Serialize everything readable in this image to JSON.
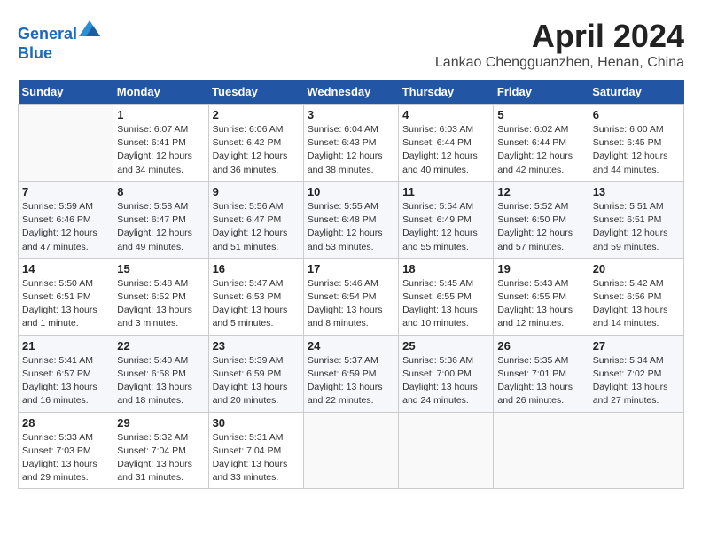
{
  "header": {
    "logo_line1": "General",
    "logo_line2": "Blue",
    "month_title": "April 2024",
    "subtitle": "Lankao Chengguanzhen, Henan, China"
  },
  "columns": [
    "Sunday",
    "Monday",
    "Tuesday",
    "Wednesday",
    "Thursday",
    "Friday",
    "Saturday"
  ],
  "weeks": [
    [
      {
        "day": "",
        "detail": ""
      },
      {
        "day": "1",
        "detail": "Sunrise: 6:07 AM\nSunset: 6:41 PM\nDaylight: 12 hours\nand 34 minutes."
      },
      {
        "day": "2",
        "detail": "Sunrise: 6:06 AM\nSunset: 6:42 PM\nDaylight: 12 hours\nand 36 minutes."
      },
      {
        "day": "3",
        "detail": "Sunrise: 6:04 AM\nSunset: 6:43 PM\nDaylight: 12 hours\nand 38 minutes."
      },
      {
        "day": "4",
        "detail": "Sunrise: 6:03 AM\nSunset: 6:44 PM\nDaylight: 12 hours\nand 40 minutes."
      },
      {
        "day": "5",
        "detail": "Sunrise: 6:02 AM\nSunset: 6:44 PM\nDaylight: 12 hours\nand 42 minutes."
      },
      {
        "day": "6",
        "detail": "Sunrise: 6:00 AM\nSunset: 6:45 PM\nDaylight: 12 hours\nand 44 minutes."
      }
    ],
    [
      {
        "day": "7",
        "detail": "Sunrise: 5:59 AM\nSunset: 6:46 PM\nDaylight: 12 hours\nand 47 minutes."
      },
      {
        "day": "8",
        "detail": "Sunrise: 5:58 AM\nSunset: 6:47 PM\nDaylight: 12 hours\nand 49 minutes."
      },
      {
        "day": "9",
        "detail": "Sunrise: 5:56 AM\nSunset: 6:47 PM\nDaylight: 12 hours\nand 51 minutes."
      },
      {
        "day": "10",
        "detail": "Sunrise: 5:55 AM\nSunset: 6:48 PM\nDaylight: 12 hours\nand 53 minutes."
      },
      {
        "day": "11",
        "detail": "Sunrise: 5:54 AM\nSunset: 6:49 PM\nDaylight: 12 hours\nand 55 minutes."
      },
      {
        "day": "12",
        "detail": "Sunrise: 5:52 AM\nSunset: 6:50 PM\nDaylight: 12 hours\nand 57 minutes."
      },
      {
        "day": "13",
        "detail": "Sunrise: 5:51 AM\nSunset: 6:51 PM\nDaylight: 12 hours\nand 59 minutes."
      }
    ],
    [
      {
        "day": "14",
        "detail": "Sunrise: 5:50 AM\nSunset: 6:51 PM\nDaylight: 13 hours\nand 1 minute."
      },
      {
        "day": "15",
        "detail": "Sunrise: 5:48 AM\nSunset: 6:52 PM\nDaylight: 13 hours\nand 3 minutes."
      },
      {
        "day": "16",
        "detail": "Sunrise: 5:47 AM\nSunset: 6:53 PM\nDaylight: 13 hours\nand 5 minutes."
      },
      {
        "day": "17",
        "detail": "Sunrise: 5:46 AM\nSunset: 6:54 PM\nDaylight: 13 hours\nand 8 minutes."
      },
      {
        "day": "18",
        "detail": "Sunrise: 5:45 AM\nSunset: 6:55 PM\nDaylight: 13 hours\nand 10 minutes."
      },
      {
        "day": "19",
        "detail": "Sunrise: 5:43 AM\nSunset: 6:55 PM\nDaylight: 13 hours\nand 12 minutes."
      },
      {
        "day": "20",
        "detail": "Sunrise: 5:42 AM\nSunset: 6:56 PM\nDaylight: 13 hours\nand 14 minutes."
      }
    ],
    [
      {
        "day": "21",
        "detail": "Sunrise: 5:41 AM\nSunset: 6:57 PM\nDaylight: 13 hours\nand 16 minutes."
      },
      {
        "day": "22",
        "detail": "Sunrise: 5:40 AM\nSunset: 6:58 PM\nDaylight: 13 hours\nand 18 minutes."
      },
      {
        "day": "23",
        "detail": "Sunrise: 5:39 AM\nSunset: 6:59 PM\nDaylight: 13 hours\nand 20 minutes."
      },
      {
        "day": "24",
        "detail": "Sunrise: 5:37 AM\nSunset: 6:59 PM\nDaylight: 13 hours\nand 22 minutes."
      },
      {
        "day": "25",
        "detail": "Sunrise: 5:36 AM\nSunset: 7:00 PM\nDaylight: 13 hours\nand 24 minutes."
      },
      {
        "day": "26",
        "detail": "Sunrise: 5:35 AM\nSunset: 7:01 PM\nDaylight: 13 hours\nand 26 minutes."
      },
      {
        "day": "27",
        "detail": "Sunrise: 5:34 AM\nSunset: 7:02 PM\nDaylight: 13 hours\nand 27 minutes."
      }
    ],
    [
      {
        "day": "28",
        "detail": "Sunrise: 5:33 AM\nSunset: 7:03 PM\nDaylight: 13 hours\nand 29 minutes."
      },
      {
        "day": "29",
        "detail": "Sunrise: 5:32 AM\nSunset: 7:04 PM\nDaylight: 13 hours\nand 31 minutes."
      },
      {
        "day": "30",
        "detail": "Sunrise: 5:31 AM\nSunset: 7:04 PM\nDaylight: 13 hours\nand 33 minutes."
      },
      {
        "day": "",
        "detail": ""
      },
      {
        "day": "",
        "detail": ""
      },
      {
        "day": "",
        "detail": ""
      },
      {
        "day": "",
        "detail": ""
      }
    ]
  ]
}
